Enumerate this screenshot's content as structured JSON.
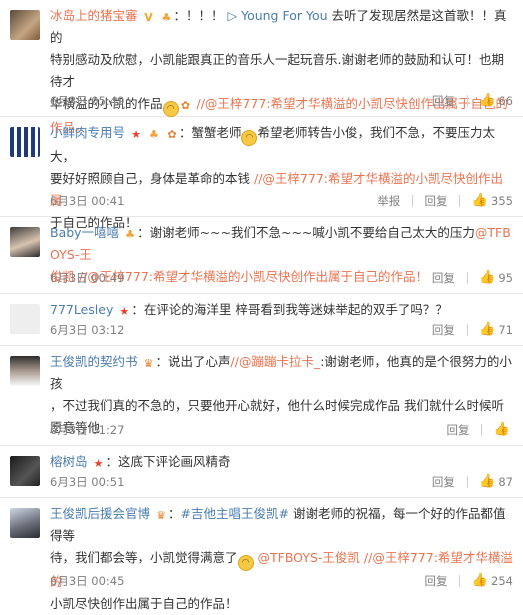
{
  "comments": [
    {
      "user": "冰岛上的猪宝審",
      "icons": [
        "vip-icon",
        "cake-icon"
      ],
      "prefix": "：！！！",
      "music": "Young For You",
      "lines": [
        "去听了发现居然是这首歌！！真的",
        "特别感动及欣慰，小凯能跟真正的音乐人一起玩音乐.谢谢老师的鼓励和认可！也期待才",
        "华横溢的小凯的作品",
        "//@王梓777:希望才华横溢的小凯尽快创作出属于自己的作品。"
      ],
      "time": "6月3日 05:49",
      "reply": "回复",
      "likes": "66"
    },
    {
      "user": "小鲜肉专用号",
      "icons": [
        "star-icon",
        "cake-icon",
        "badge-icon"
      ],
      "prefix": "：蟹蟹老师",
      "lines": [
        "希望老师转告小俊，我们不急，不要压力太大，",
        "要好好照顾自己，身体是革命的本钱",
        "//@王梓777:希望才华横溢的小凯尽快创作出属",
        "于自己的作品！"
      ],
      "time": "6月3日 00:41",
      "report": "举报",
      "reply": "回复",
      "likes": "355"
    },
    {
      "user": "Baby一嘻嘻",
      "icons": [
        "cake-icon"
      ],
      "prefix": "：谢谢老师~~~我们不急~~~喊小凯不要给自己太大的压力",
      "at1": "@TFBOYS-王",
      "lines": [
        "俊凯",
        "//@王梓777:希望才华横溢的小凯尽快创作出属于自己的作品！"
      ],
      "time": "6月3日 00:49",
      "reply": "回复",
      "likes": "95"
    },
    {
      "user": "777Lesley",
      "icons": [
        "star-icon"
      ],
      "prefix": "：在评论的海洋里 梓哥看到我等迷妹举起的双手了吗？？",
      "time": "6月3日 03:12",
      "reply": "回复",
      "likes": "71"
    },
    {
      "user": "王俊凯的契约书",
      "icons": [
        "crown-icon"
      ],
      "prefix": "：说出了心声",
      "at1": "//@蹦蹦卡拉卡_",
      "lines": [
        ":谢谢老师，他真的是个很努力的小孩",
        "，不过我们真的不急的，只要他开心就好，他什么时候完成作品 我们就什么时候听",
        "愿意等他"
      ],
      "time": "6月3日 01:27",
      "reply": "回复",
      "likes": ""
    },
    {
      "user": "榕树岛",
      "icons": [
        "star-icon"
      ],
      "prefix": "：这底下评论画风精奇",
      "time": "6月3日 00:51",
      "reply": "回复",
      "likes": "87"
    },
    {
      "user": "王俊凯后援会官博",
      "icons": [
        "crown-icon"
      ],
      "prefix": "：",
      "topic": "#吉他主唱王俊凯#",
      "lines": [
        "谢谢老师的祝福，每一个好的作品都值得等",
        "待，我们都会等，小凯觉得满意了",
        "@TFBOYS-王俊凯",
        "//@王梓777:希望才华横溢的",
        "小凯尽快创作出属于自己的作品！"
      ],
      "time": "6月3日 00:45",
      "reply": "回复",
      "likes": "254"
    }
  ]
}
